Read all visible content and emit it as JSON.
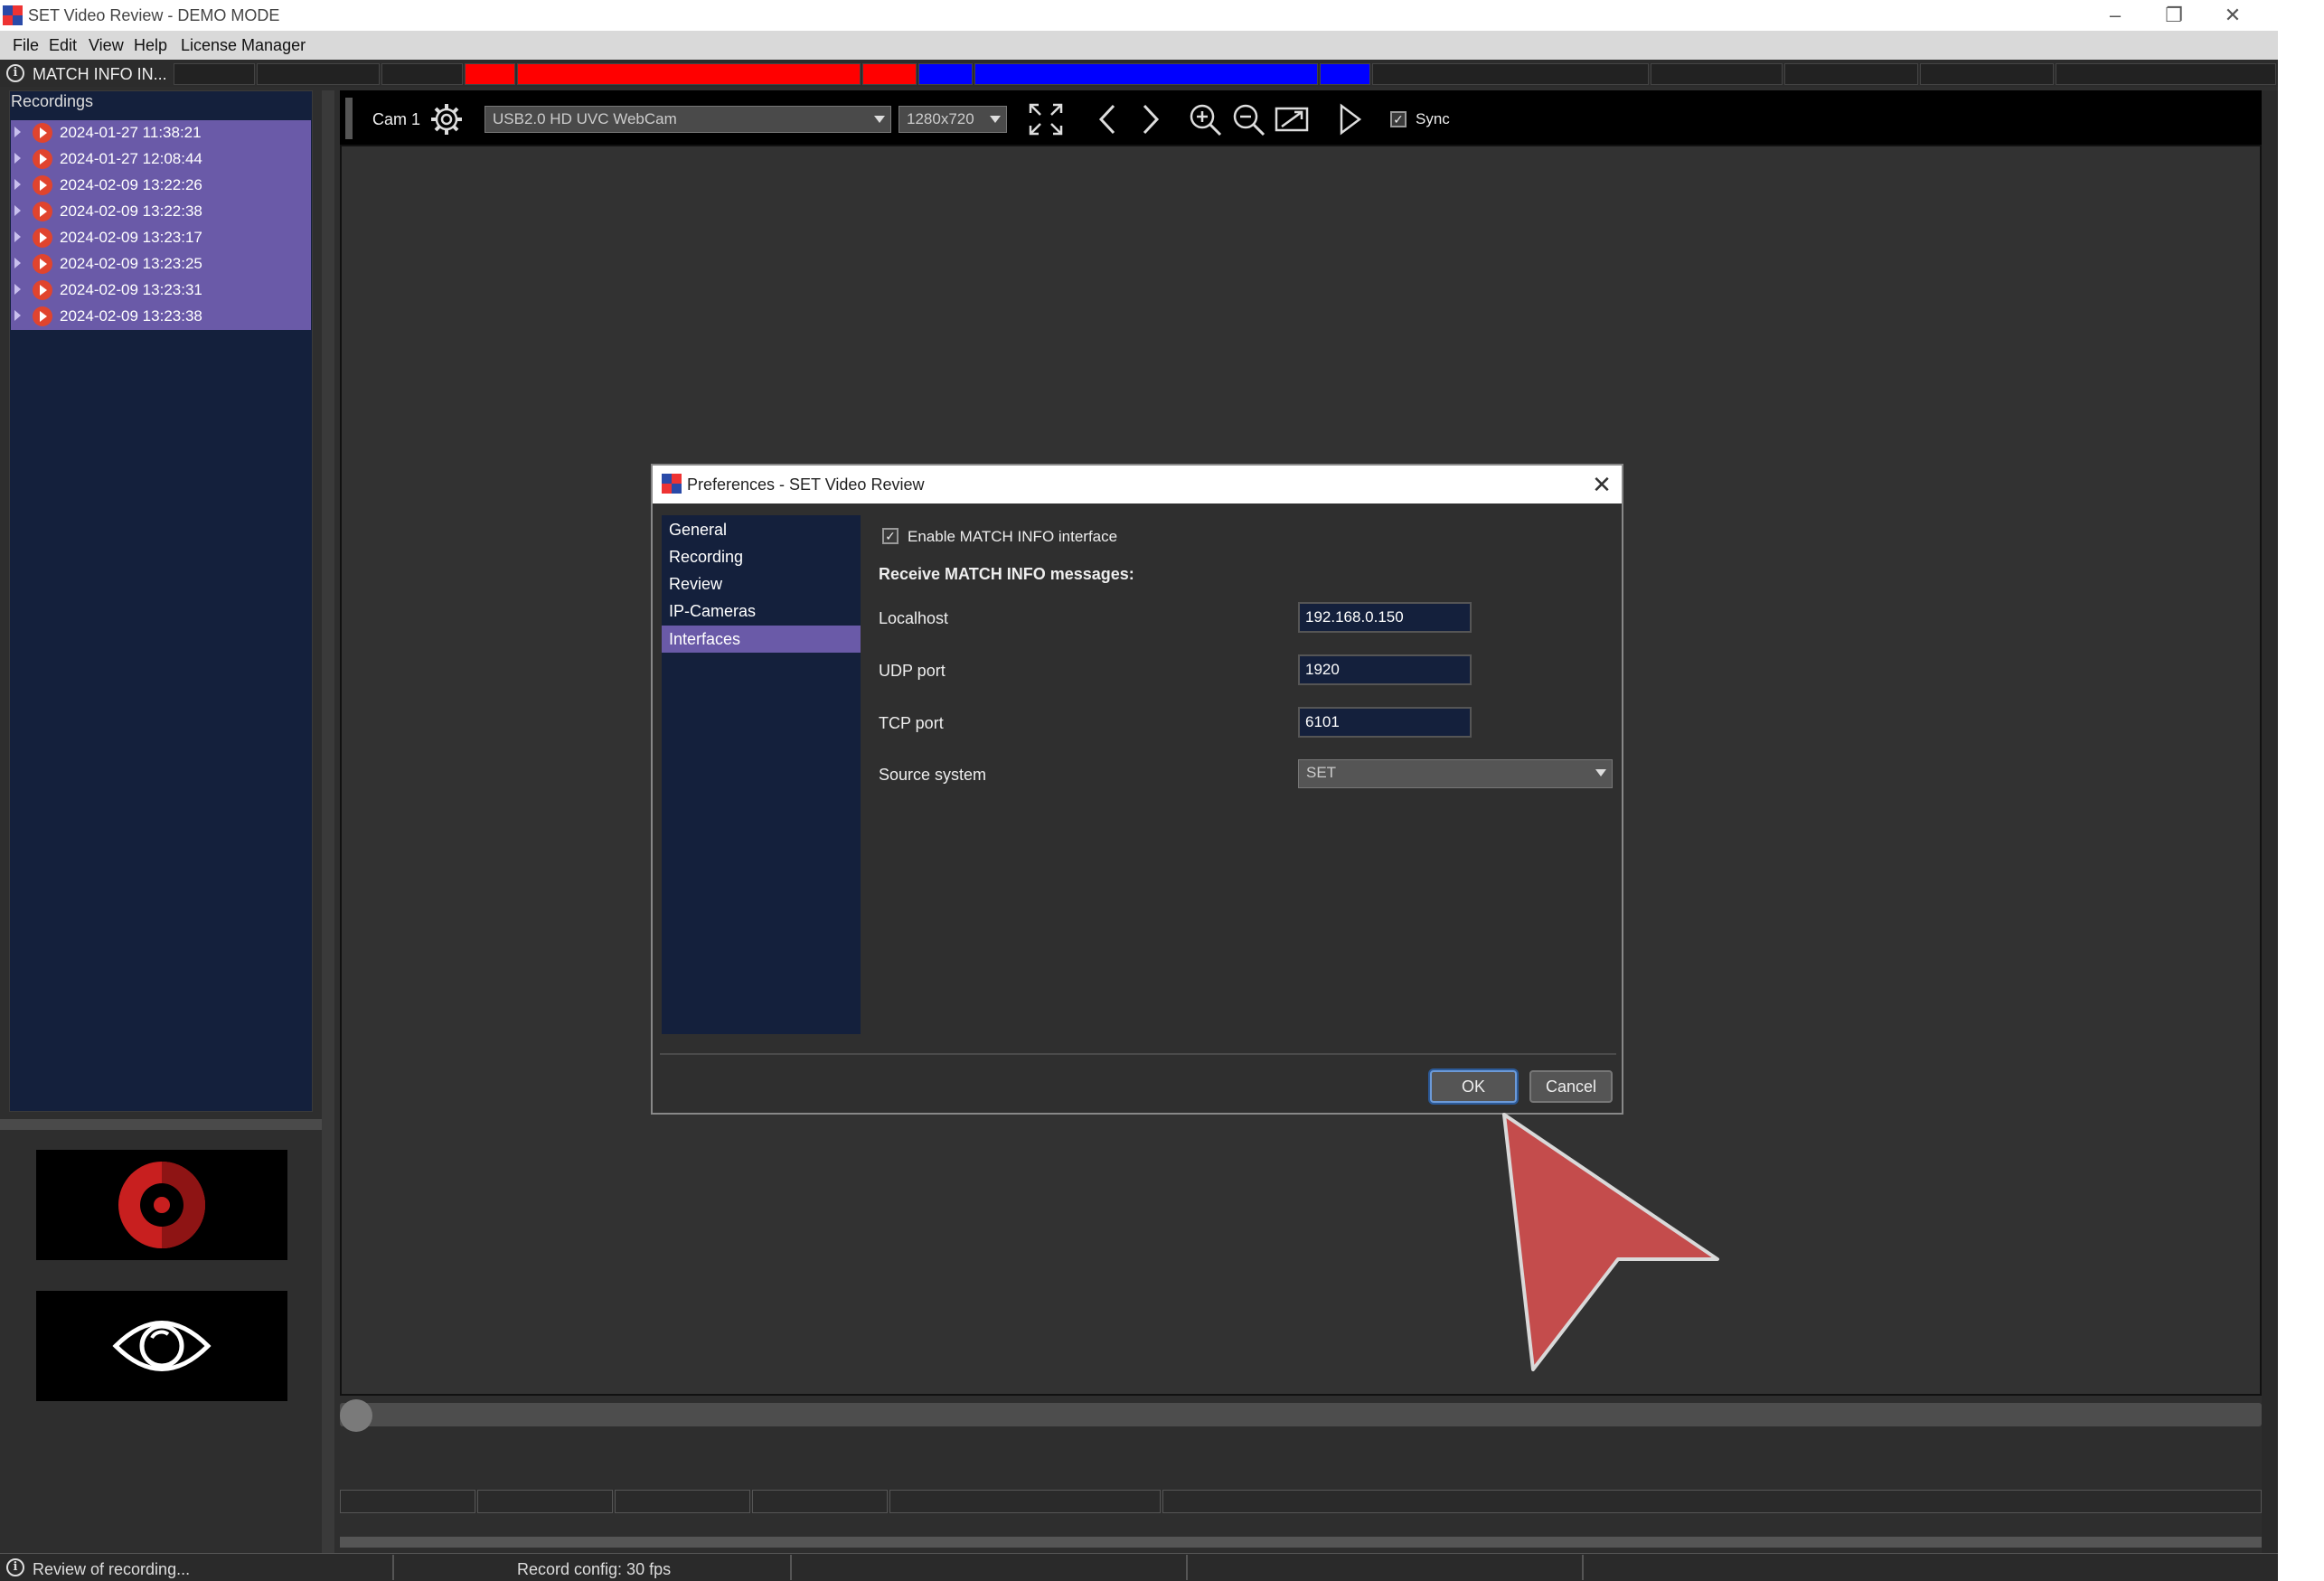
{
  "window": {
    "title": "SET Video Review - DEMO MODE",
    "controls": [
      "minimize-icon",
      "restore-icon",
      "close-icon"
    ]
  },
  "menu": {
    "file": "File",
    "edit": "Edit",
    "view": "View",
    "help": "Help",
    "license": "License Manager"
  },
  "infobar": {
    "label": "MATCH INFO IN..."
  },
  "recordings": {
    "header": "Recordings",
    "items": [
      "2024-01-27 11:38:21",
      "2024-01-27 12:08:44",
      "2024-02-09 13:22:26",
      "2024-02-09 13:22:38",
      "2024-02-09 13:23:17",
      "2024-02-09 13:23:25",
      "2024-02-09 13:23:31",
      "2024-02-09 13:23:38"
    ]
  },
  "toolbar": {
    "cam_label": "Cam 1",
    "camera_select": "USB2.0 HD UVC WebCam",
    "resolution_select": "1280x720",
    "sync_label": "Sync",
    "sync_checked": true
  },
  "status": {
    "left": "Review of recording...",
    "record_config": "Record config: 30 fps"
  },
  "dialog": {
    "title": "Preferences - SET Video Review",
    "nav": [
      "General",
      "Recording",
      "Review",
      "IP-Cameras",
      "Interfaces"
    ],
    "selected_nav": "Interfaces",
    "enable_label": "Enable MATCH INFO interface",
    "enable_checked": true,
    "section_heading": "Receive MATCH INFO messages:",
    "fields": {
      "localhost_label": "Localhost",
      "localhost_value": "192.168.0.150",
      "udp_label": "UDP port",
      "udp_value": "1920",
      "tcp_label": "TCP port",
      "tcp_value": "6101",
      "source_label": "Source system",
      "source_value": "SET"
    },
    "ok_label": "OK",
    "cancel_label": "Cancel"
  },
  "colors": {
    "accent_purple": "#6a5aa8",
    "nav_dark": "#14203c",
    "red_segment": "#ff0000",
    "blue_segment": "#0000ff",
    "cursor_red": "#c44c4c"
  }
}
